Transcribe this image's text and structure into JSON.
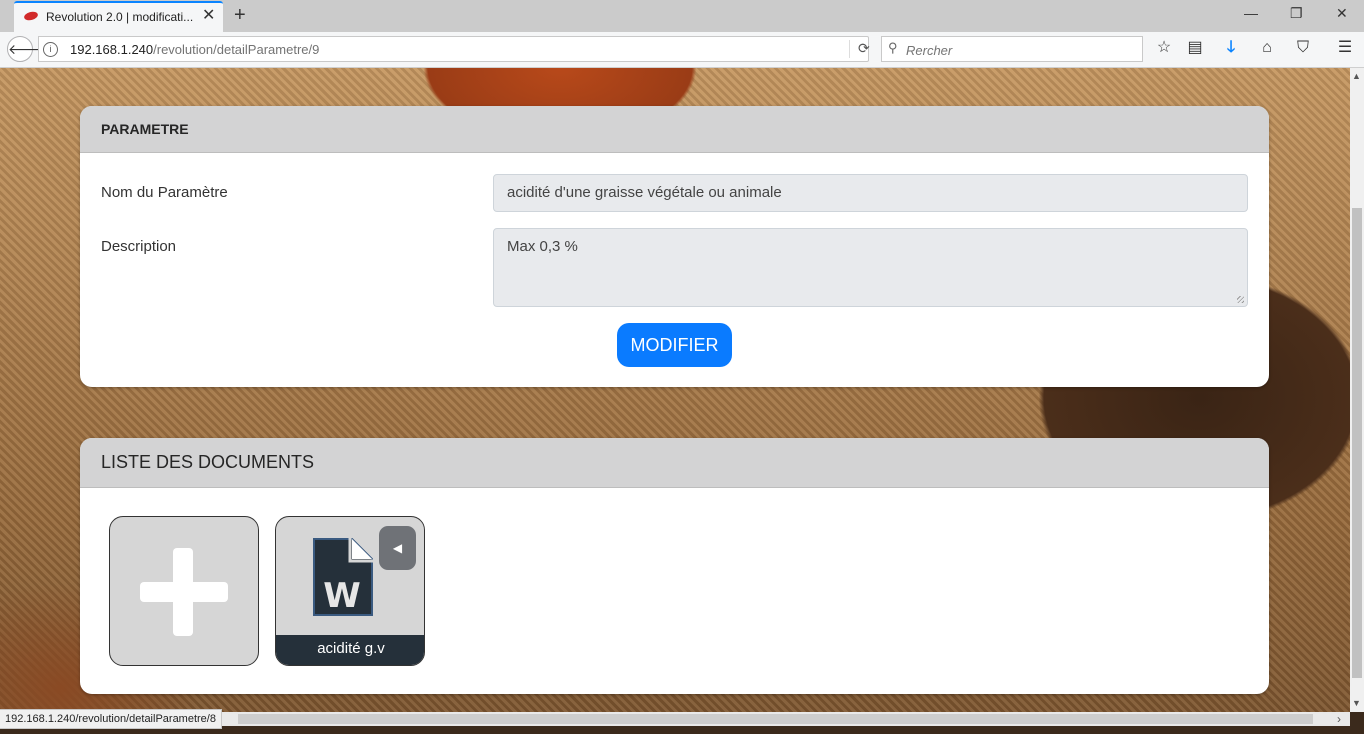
{
  "browser": {
    "tab_title": "Revolution 2.0 | modificati...",
    "tab_close": "✕",
    "new_tab": "+",
    "url_host": "192.168.1.240",
    "url_path": "/revolution/detailParametre/9",
    "search_placeholder": "Rercher",
    "status_url": "192.168.1.240/revolution/detailParametre/8"
  },
  "icons": {
    "back": "arrow-left-icon",
    "info": "info-icon",
    "reload": "reload-icon",
    "search": "search-icon",
    "bookmark": "star-icon",
    "reader": "reader-list-icon",
    "download": "download-arrow-icon",
    "home": "home-icon",
    "pocket": "pocket-icon",
    "menu": "hamburger-menu-icon",
    "add": "plus-icon",
    "word": "word-document-icon",
    "toggle": "caret-left-icon"
  },
  "parametre": {
    "header": "PARAMETRE",
    "name_label": "Nom du Paramètre",
    "name_value": "acidité  d'une graisse végétale ou animale",
    "description_label": "Description",
    "description_value": "Max 0,3 %",
    "modify_button": "MODIFIER"
  },
  "documents": {
    "header": "LISTE DES DOCUMENTS",
    "items": [
      {
        "label": "acidité g.v"
      }
    ]
  },
  "colors": {
    "accent": "#0a7bff",
    "tab_accent": "#0a84ff",
    "download_icon": "#0a84ff",
    "card_header_bg": "#d3d3d4",
    "tile_footer_bg": "#25303a"
  }
}
